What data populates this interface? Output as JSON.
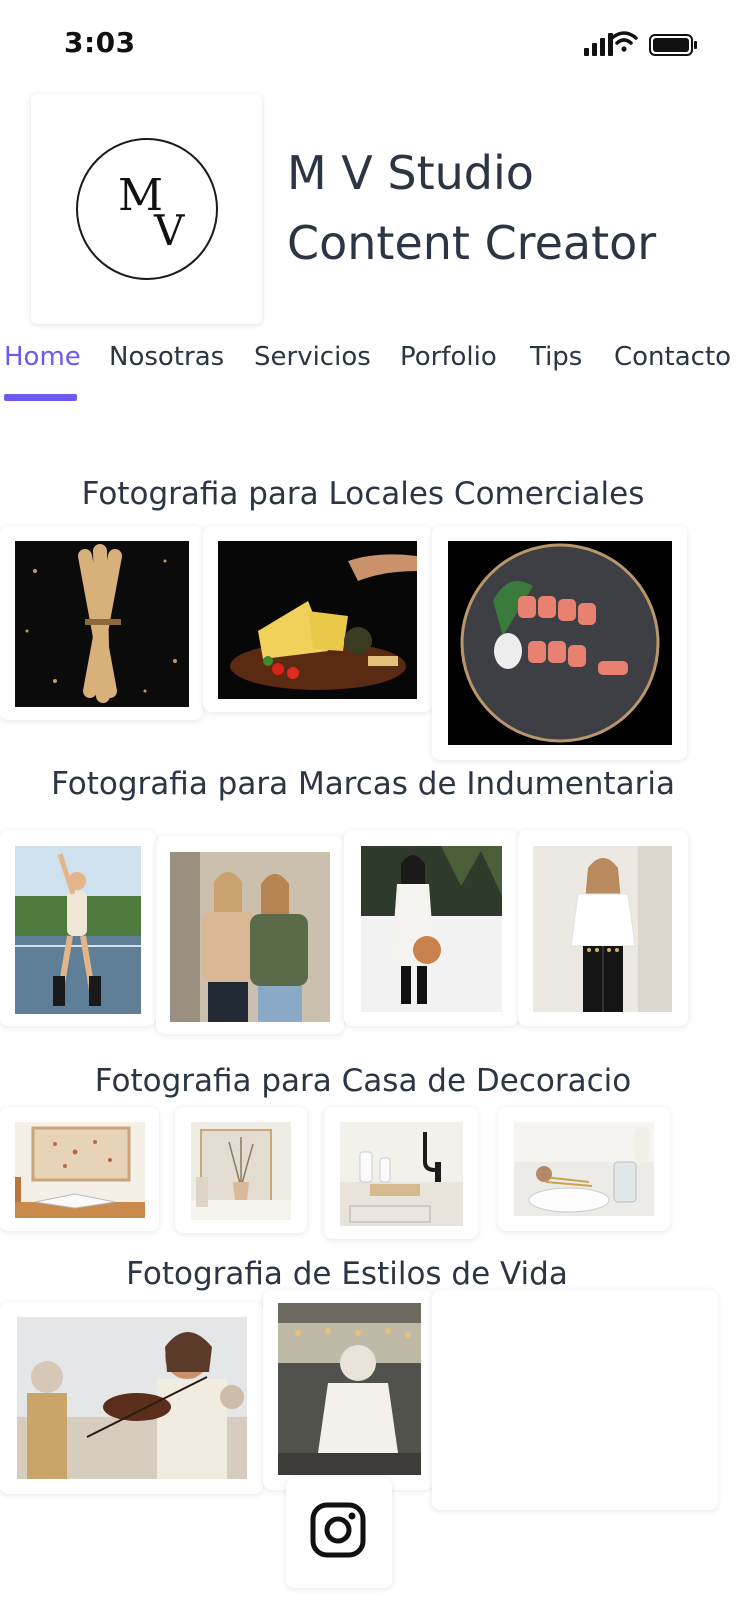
{
  "status_bar": {
    "time": "3:03",
    "icons": [
      "signal-icon",
      "wifi-icon",
      "battery-icon"
    ]
  },
  "header": {
    "logo": {
      "initial_1": "M",
      "initial_2": "V"
    },
    "title_line_1": "M V Studio",
    "title_line_2": "Content Creator"
  },
  "nav": {
    "items": [
      "Home",
      "Nosotras",
      "Servicios",
      "Porfolio",
      "Tips",
      "Contacto"
    ],
    "active_index": 0,
    "accent_color": "#6a5cf3"
  },
  "sections": [
    {
      "title": "Fotografia para Locales Comerciales",
      "photos": [
        "breadsticks-photo",
        "cheese-board-photo",
        "sushi-plate-photo"
      ]
    },
    {
      "title": "Fotografia para Marcas de Indumentaria",
      "photos": [
        "tennis-court-model-photo",
        "two-women-sweaters-photo",
        "white-coat-model-photo",
        "white-blouse-model-photo"
      ]
    },
    {
      "title": "Fotografia para Casa de Decoracio",
      "photos": [
        "art-print-books-photo",
        "vase-frame-photo",
        "bathroom-counter-photo",
        "table-setting-photo"
      ]
    },
    {
      "title": "Fotografia de Estilos de Vida",
      "photos": [
        "violinist-photo",
        "outdoor-dinner-photo"
      ]
    }
  ],
  "footer": {
    "social_icon": "instagram-icon"
  }
}
